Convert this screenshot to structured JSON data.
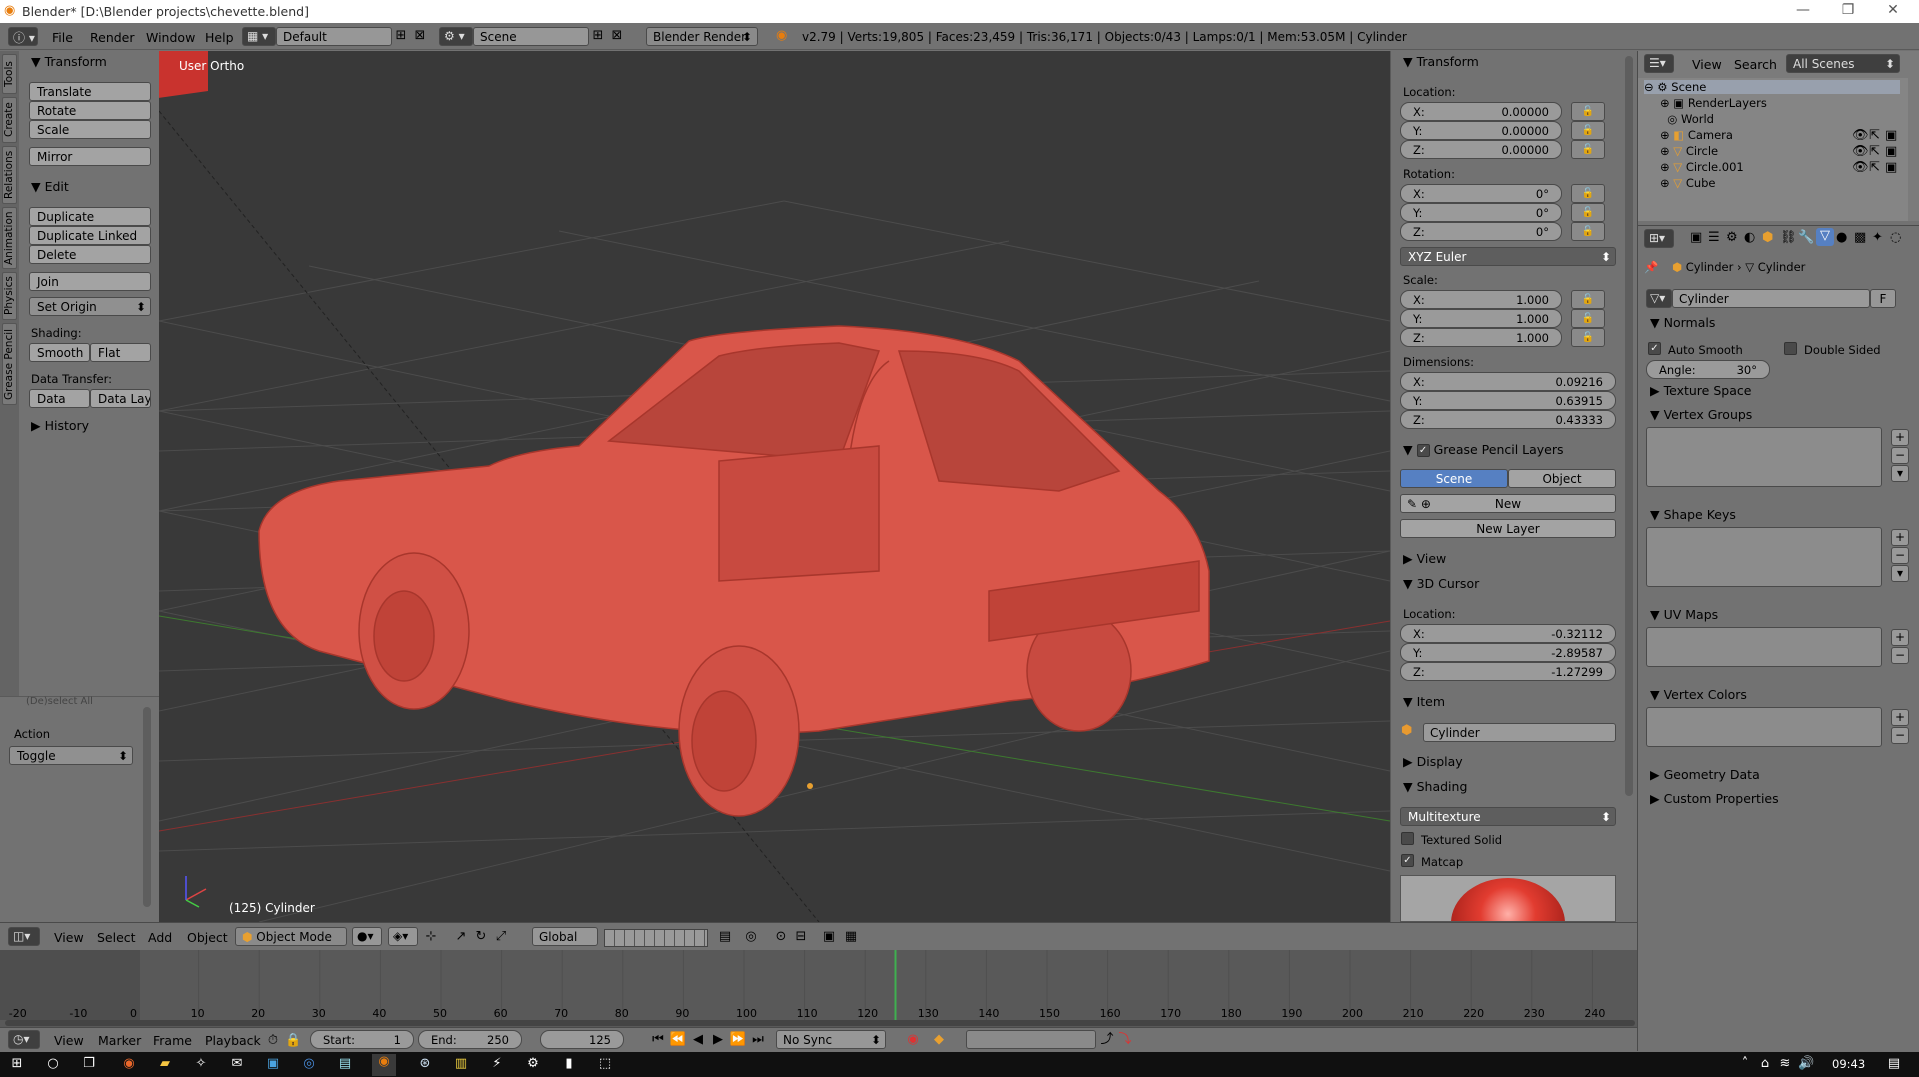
{
  "window": {
    "title": "Blender* [D:\\Blender projects\\chevette.blend]"
  },
  "topbar": {
    "menus": [
      "File",
      "Render",
      "Window",
      "Help"
    ],
    "screen_layout": "Default",
    "scene": "Scene",
    "render_engine": "Blender Render",
    "stats": "v2.79 | Verts:19,805 | Faces:23,459 | Tris:36,171 | Objects:0/43 | Lamps:0/1 | Mem:53.05M | Cylinder"
  },
  "tool_tabs": [
    "Tools",
    "Create",
    "Relations",
    "Animation",
    "Physics",
    "Grease Pencil"
  ],
  "toolshelf": {
    "transform_title": "Transform",
    "translate": "Translate",
    "rotate": "Rotate",
    "scale": "Scale",
    "mirror": "Mirror",
    "edit_title": "Edit",
    "duplicate": "Duplicate",
    "duplicate_linked": "Duplicate Linked",
    "delete": "Delete",
    "join": "Join",
    "set_origin": "Set Origin",
    "shading_label": "Shading:",
    "smooth": "Smooth",
    "flat": "Flat",
    "data_transfer_label": "Data Transfer:",
    "data": "Data",
    "data_layo": "Data Layo",
    "history_title": "History",
    "operator_label": "(De)select All",
    "action_label": "Action",
    "action_value": "Toggle"
  },
  "viewport": {
    "view_name": "User Ortho",
    "object_label": "(125) Cylinder",
    "car_color": "#d9564a"
  },
  "npanel": {
    "transform_title": "Transform",
    "location_label": "Location:",
    "location": [
      {
        "k": "X:",
        "v": "0.00000"
      },
      {
        "k": "Y:",
        "v": "0.00000"
      },
      {
        "k": "Z:",
        "v": "0.00000"
      }
    ],
    "rotation_label": "Rotation:",
    "rotation": [
      {
        "k": "X:",
        "v": "0°"
      },
      {
        "k": "Y:",
        "v": "0°"
      },
      {
        "k": "Z:",
        "v": "0°"
      }
    ],
    "rotation_mode": "XYZ Euler",
    "scale_label": "Scale:",
    "scale": [
      {
        "k": "X:",
        "v": "1.000"
      },
      {
        "k": "Y:",
        "v": "1.000"
      },
      {
        "k": "Z:",
        "v": "1.000"
      }
    ],
    "dimensions_label": "Dimensions:",
    "dimensions": [
      {
        "k": "X:",
        "v": "0.09216"
      },
      {
        "k": "Y:",
        "v": "0.63915"
      },
      {
        "k": "Z:",
        "v": "0.43333"
      }
    ],
    "grease_title": "Grease Pencil Layers",
    "gp_scene": "Scene",
    "gp_object": "Object",
    "gp_new": "New",
    "gp_new_layer": "New Layer",
    "view_title": "View",
    "cursor_title": "3D Cursor",
    "cursor_location_label": "Location:",
    "cursor_location": [
      {
        "k": "X:",
        "v": "-0.32112"
      },
      {
        "k": "Y:",
        "v": "-2.89587"
      },
      {
        "k": "Z:",
        "v": "-1.27299"
      }
    ],
    "item_title": "Item",
    "item_name": "Cylinder",
    "display_title": "Display",
    "shading_title": "Shading",
    "shading_mode": "Multitexture",
    "textured_solid": "Textured Solid",
    "matcap": "Matcap"
  },
  "outliner": {
    "view": "View",
    "search": "Search",
    "filter": "All Scenes",
    "items": [
      "Scene",
      "RenderLayers",
      "World",
      "Camera",
      "Circle",
      "Circle.001",
      "Cube"
    ]
  },
  "properties": {
    "breadcrumb_obj": "Cylinder",
    "breadcrumb_data": "Cylinder",
    "mesh_name": "Cylinder",
    "fake_user": "F",
    "normals_title": "Normals",
    "auto_smooth": "Auto Smooth",
    "double_sided": "Double Sided",
    "angle": "Angle:",
    "angle_value": "30°",
    "sections": [
      "Texture Space",
      "Vertex Groups",
      "Shape Keys",
      "UV Maps",
      "Vertex Colors",
      "Geometry Data",
      "Custom Properties"
    ]
  },
  "view_header": {
    "view": "View",
    "select": "Select",
    "add": "Add",
    "object": "Object",
    "mode": "Object Mode",
    "orientation": "Global"
  },
  "timeline": {
    "ticks": [
      "-20",
      "-10",
      "0",
      "10",
      "20",
      "30",
      "40",
      "50",
      "60",
      "70",
      "80",
      "90",
      "100",
      "110",
      "120",
      "130",
      "140",
      "150",
      "160",
      "170",
      "180",
      "190",
      "200",
      "210",
      "220",
      "230",
      "240"
    ],
    "current_frame": 125,
    "view": "View",
    "marker": "Marker",
    "frame": "Frame",
    "playback": "Playback",
    "start_label": "Start:",
    "start_value": "1",
    "end_label": "End:",
    "end_value": "250",
    "frame_value": "125",
    "sync": "No Sync"
  },
  "taskbar": {
    "clock": "09:43"
  }
}
